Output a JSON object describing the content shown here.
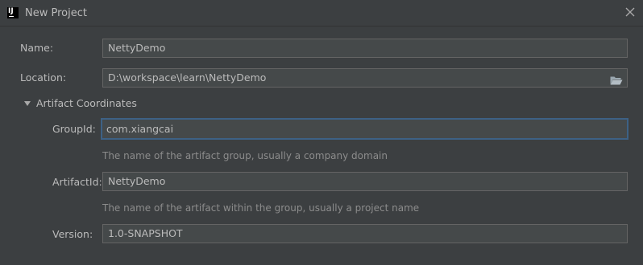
{
  "window": {
    "title": "New Project",
    "app_icon_text": "IJ"
  },
  "form": {
    "name_label": "Name:",
    "name_value": "NettyDemo",
    "location_label": "Location:",
    "location_value": "D:\\workspace\\learn\\NettyDemo",
    "artifact_section_label": "Artifact Coordinates",
    "groupid_label": "GroupId:",
    "groupid_value": "com.xiangcai",
    "groupid_hint": "The name of the artifact group, usually a company domain",
    "artifactid_label": "ArtifactId:",
    "artifactid_value": "NettyDemo",
    "artifactid_hint": "The name of the artifact within the group, usually a project name",
    "version_label": "Version:",
    "version_value": "1.0-SNAPSHOT"
  },
  "icons": {
    "app": "intellij-idea-icon",
    "close": "close-icon",
    "folder": "folder-open-icon",
    "expand": "triangle-down-icon"
  },
  "colors": {
    "background": "#3c3f41",
    "field_background": "#45494a",
    "field_border": "#646464",
    "focus_border": "#3d6185",
    "text": "#bbbbbb",
    "hint_text": "#8c8c8c"
  }
}
